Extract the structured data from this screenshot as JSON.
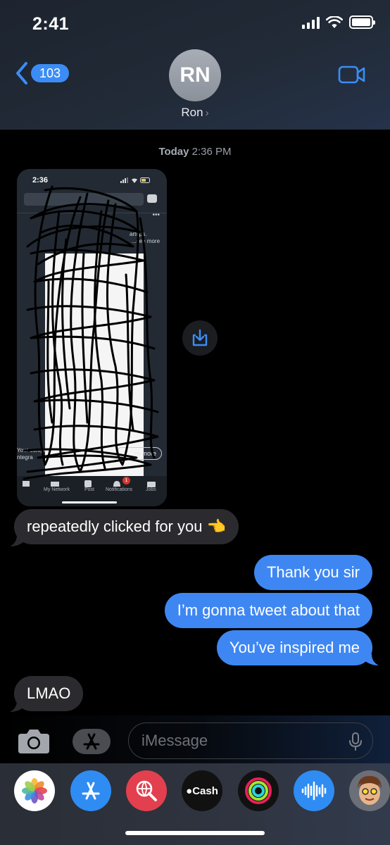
{
  "status_bar": {
    "time": "2:41"
  },
  "header": {
    "back_count": "103",
    "avatar_initials": "RN",
    "contact_name": "Ron",
    "accent": "#3b8df5"
  },
  "conversation": {
    "timestamp_day": "Today",
    "timestamp_time": "2:36 PM",
    "attachment": {
      "time": "2:36",
      "snippet_1": "artups.",
      "snippet_2": "...see more",
      "snippet_3": "Your compet",
      "snippet_4": "ntegra",
      "pill_text": "rn more",
      "tabs": [
        "My Network",
        "Post",
        "Notifications",
        "Jobs"
      ],
      "notification_badge": "1"
    },
    "messages": [
      {
        "direction": "incoming",
        "text": "repeatedly clicked for you 👈"
      },
      {
        "direction": "outgoing",
        "text": "Thank you sir"
      },
      {
        "direction": "outgoing",
        "text": "I’m gonna tweet about that"
      },
      {
        "direction": "outgoing",
        "text": "You’ve inspired me"
      },
      {
        "direction": "incoming",
        "text": "LMAO"
      }
    ]
  },
  "input": {
    "placeholder": "iMessage"
  },
  "app_drawer": [
    {
      "name": "photos-app",
      "icon": "photos-icon"
    },
    {
      "name": "app-store-app",
      "icon": "app-store-icon"
    },
    {
      "name": "web-search-app",
      "icon": "globe-search-icon"
    },
    {
      "name": "apple-cash-app",
      "label": "Cash",
      "icon": "apple-cash-icon"
    },
    {
      "name": "activity-app",
      "icon": "activity-rings-icon"
    },
    {
      "name": "audio-message-app",
      "icon": "waveform-icon"
    },
    {
      "name": "memoji-app",
      "icon": "memoji-icon"
    }
  ]
}
